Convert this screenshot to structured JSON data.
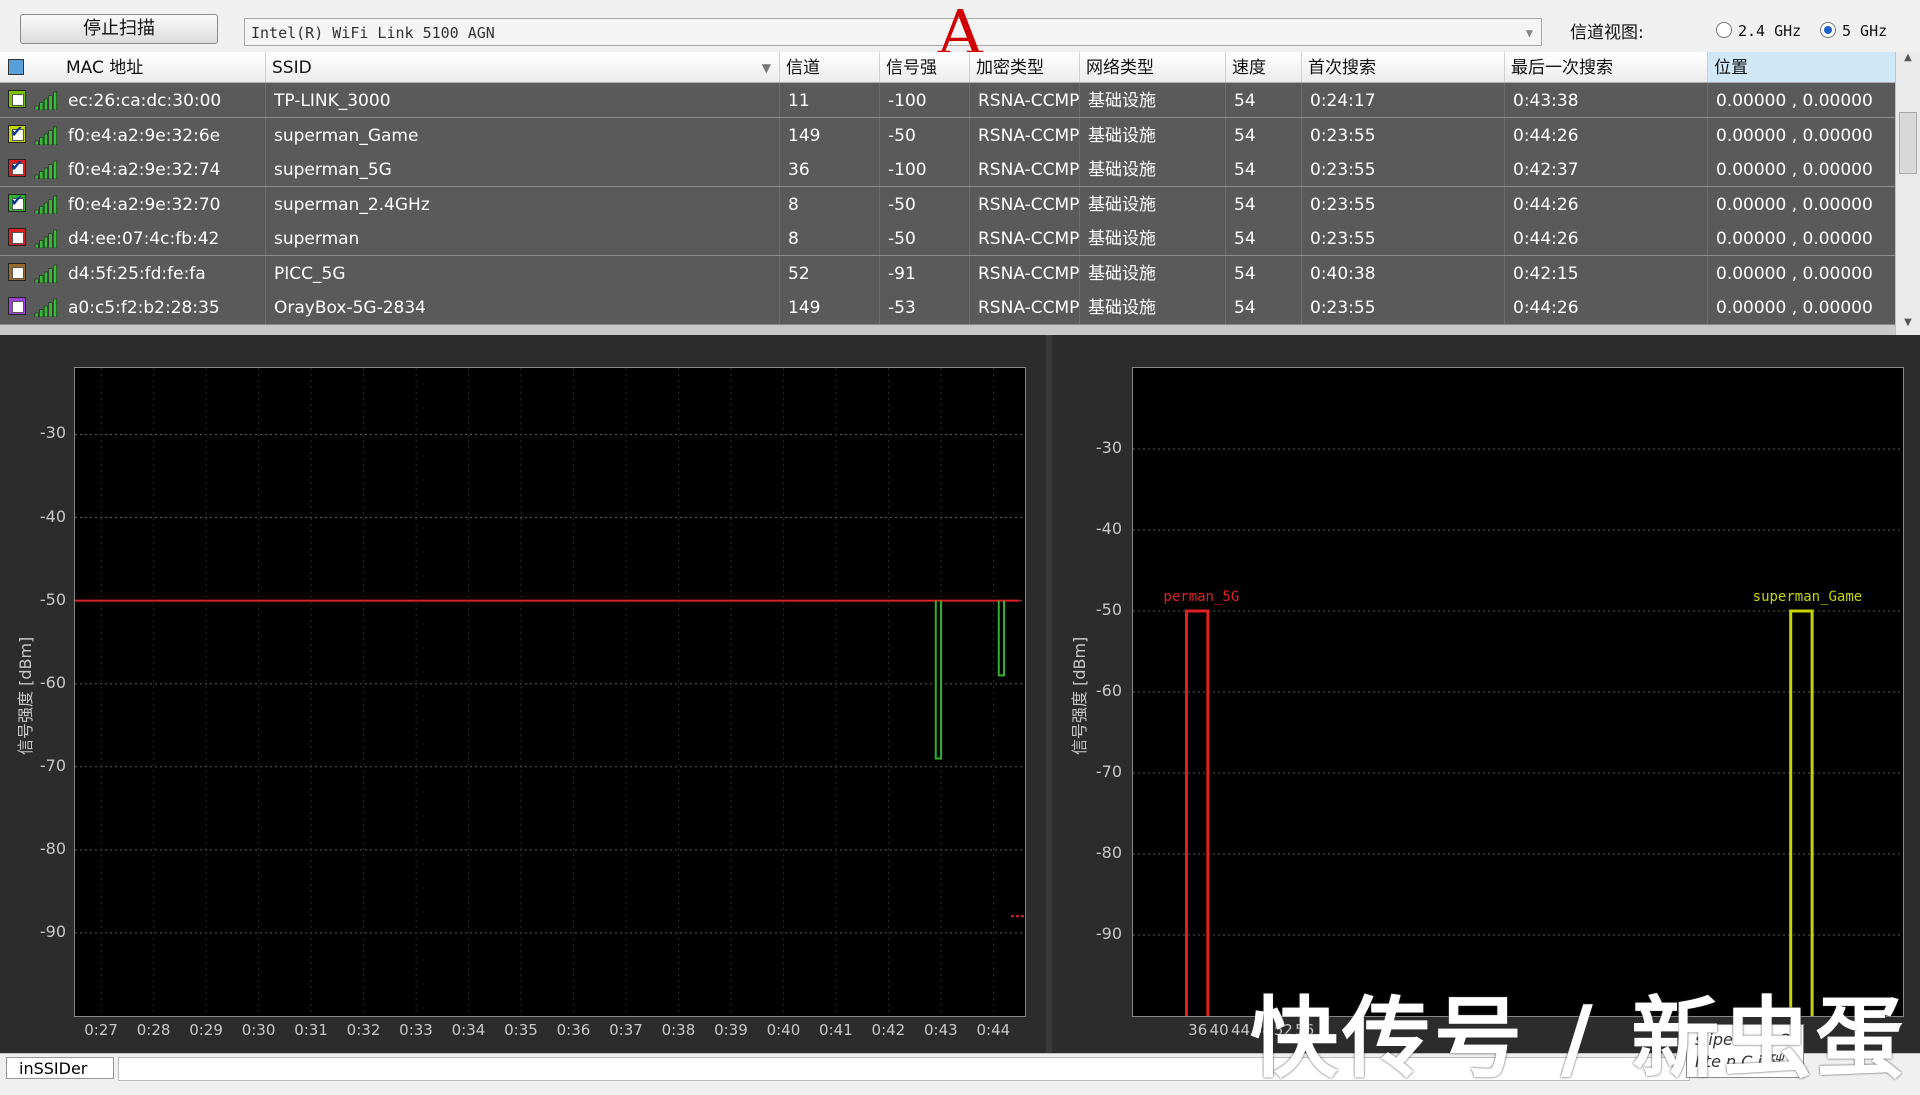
{
  "toolbar": {
    "stop_scan": "停止扫描",
    "adapter": "Intel(R) WiFi Link 5100 AGN",
    "channel_view_label": "信道视图:",
    "band_24": "2.4 GHz",
    "band_5": "5 GHz",
    "selected_band": "5 GHz",
    "annotation": "A"
  },
  "table": {
    "headers": [
      "MAC 地址",
      "SSID",
      "信道",
      "信号强",
      "加密类型",
      "网络类型",
      "速度",
      "首次搜索",
      "最后一次搜索",
      "位置"
    ],
    "rows": [
      {
        "color": "#7cc400",
        "checked": false,
        "mac": "ec:26:ca:dc:30:00",
        "ssid": "TP-LINK_3000",
        "channel": "11",
        "rssi": "-100",
        "security": "RSNA-CCMP",
        "network": "基础设施",
        "speed": "54",
        "first": "0:24:17",
        "last": "0:43:38",
        "location": "0.00000 , 0.00000"
      },
      {
        "color": "#c8d400",
        "checked": true,
        "mac": "f0:e4:a2:9e:32:6e",
        "ssid": "superman_Game",
        "channel": "149",
        "rssi": "-50",
        "security": "RSNA-CCMP",
        "network": "基础设施",
        "speed": "54",
        "first": "0:23:55",
        "last": "0:44:26",
        "location": "0.00000 , 0.00000"
      },
      {
        "color": "#e02020",
        "checked": true,
        "mac": "f0:e4:a2:9e:32:74",
        "ssid": "superman_5G",
        "channel": "36",
        "rssi": "-100",
        "security": "RSNA-CCMP",
        "network": "基础设施",
        "speed": "54",
        "first": "0:23:55",
        "last": "0:42:37",
        "location": "0.00000 , 0.00000"
      },
      {
        "color": "#30b030",
        "checked": true,
        "mac": "f0:e4:a2:9e:32:70",
        "ssid": "superman_2.4GHz",
        "channel": "8",
        "rssi": "-50",
        "security": "RSNA-CCMP",
        "network": "基础设施",
        "speed": "54",
        "first": "0:23:55",
        "last": "0:44:26",
        "location": "0.00000 , 0.00000"
      },
      {
        "color": "#e02020",
        "checked": false,
        "mac": "d4:ee:07:4c:fb:42",
        "ssid": "superman",
        "channel": "8",
        "rssi": "-50",
        "security": "RSNA-CCMP",
        "network": "基础设施",
        "speed": "54",
        "first": "0:23:55",
        "last": "0:44:26",
        "location": "0.00000 , 0.00000"
      },
      {
        "color": "#9a6a2a",
        "checked": false,
        "mac": "d4:5f:25:fd:fe:fa",
        "ssid": "PICC_5G",
        "channel": "52",
        "rssi": "-91",
        "security": "RSNA-CCMP",
        "network": "基础设施",
        "speed": "54",
        "first": "0:40:38",
        "last": "0:42:15",
        "location": "0.00000 , 0.00000"
      },
      {
        "color": "#a040e0",
        "checked": false,
        "mac": "a0:c5:f2:b2:28:35",
        "ssid": "OrayBox-5G-2834",
        "channel": "149",
        "rssi": "-53",
        "security": "RSNA-CCMP",
        "network": "基础设施",
        "speed": "54",
        "first": "0:23:55",
        "last": "0:44:26",
        "location": "0.00000 , 0.00000"
      }
    ]
  },
  "chart_data": [
    {
      "type": "line",
      "title": "",
      "ylabel": "信号强度 [dBm]",
      "xlabel": "",
      "y_ticks": [
        -30,
        -40,
        -50,
        -60,
        -70,
        -80,
        -90
      ],
      "ylim": [
        -100,
        -22
      ],
      "x_ticks": [
        "0:27",
        "0:28",
        "0:29",
        "0:30",
        "0:31",
        "0:32",
        "0:33",
        "0:34",
        "0:35",
        "0:36",
        "0:37",
        "0:38",
        "0:39",
        "0:40",
        "0:41",
        "0:42",
        "0:43",
        "0:44"
      ],
      "grid": true,
      "series": [
        {
          "color": "#e02020",
          "points": [
            [
              "0:26.5",
              -50
            ],
            [
              "0:44.5",
              -50
            ]
          ]
        },
        {
          "color": "#30b030",
          "points": [
            [
              "0:42.9",
              -50
            ],
            [
              "0:42.9",
              -69
            ],
            [
              "0:43.0",
              -69
            ],
            [
              "0:43.0",
              -50
            ]
          ]
        },
        {
          "color": "#30b030",
          "points": [
            [
              "0:44.1",
              -50
            ],
            [
              "0:44.1",
              -59
            ],
            [
              "0:44.2",
              -59
            ],
            [
              "0:44.2",
              -50
            ]
          ]
        }
      ]
    },
    {
      "type": "line",
      "title": "",
      "ylabel": "信号强度 [dBm]",
      "xlabel": "",
      "y_ticks": [
        -30,
        -40,
        -50,
        -60,
        -70,
        -80,
        -90
      ],
      "ylim": [
        -100,
        -20
      ],
      "x_ticks": [
        "36",
        "40",
        "44",
        "48",
        "52",
        "56"
      ],
      "grid": true,
      "series": [
        {
          "name": "superman_5G",
          "label": "perman_5G",
          "color": "#e02020",
          "channel": "36",
          "peak": -50
        },
        {
          "name": "superman_Game",
          "label": "superman_Game",
          "color": "#c8d400",
          "channel": "149",
          "peak": -50
        }
      ]
    }
  ],
  "status": {
    "tab": "inSSIDer"
  },
  "watermark": "快传号 / 新虫蛋",
  "tooltip": {
    "line1": "s iper m n  2",
    "line2": "I te n C i 础"
  }
}
